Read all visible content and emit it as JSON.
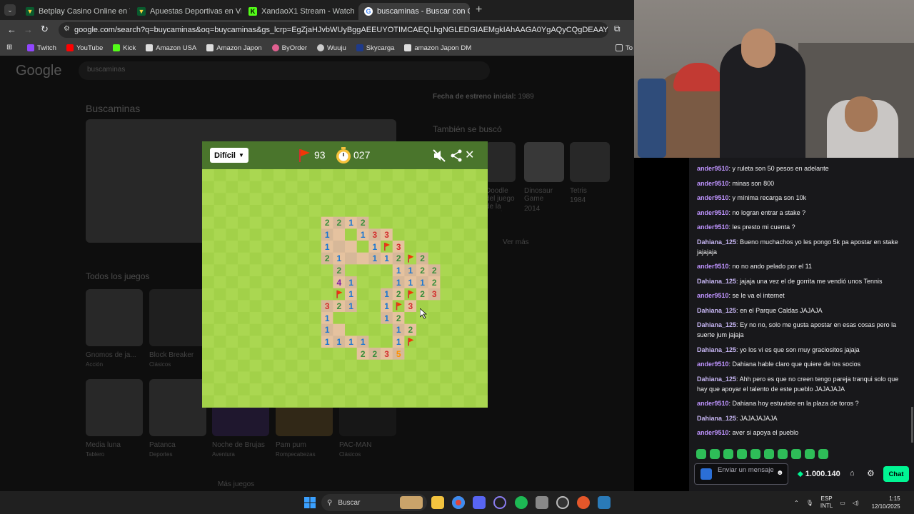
{
  "browser": {
    "tabs": [
      {
        "title": "Betplay Casino Online en Vivo |",
        "active": false
      },
      {
        "title": "Apuestas Deportivas en Vivo | A",
        "active": false
      },
      {
        "title": "XandaoX1 Stream - Watch",
        "active": false
      },
      {
        "title": "buscaminas - Buscar con Googl",
        "active": true
      }
    ],
    "new_tab": "+",
    "url": "google.com/search?q=buycaminas&oq=buycaminas&gs_lcrp=EgZjaHJvbWUyBggAEEUYOTIMCAEQLhgNGLEDGIAEMgkIAhAAGA0YgAQyCQgDEAAYDRiABDIJCAQQLhgNGI...",
    "bookmarks": [
      "Twitch",
      "YouTube",
      "Kick",
      "Amazon USA",
      "Amazon Japon",
      "ByOrder",
      "Wuuju",
      "Skycarga",
      "amazon Japon DM"
    ],
    "bookmarks_more": "To"
  },
  "google": {
    "logo": "Google",
    "query": "buscaminas",
    "heading": "Buscaminas",
    "release_label": "Fecha de estreno inicial:",
    "release_year": "1989",
    "also_searched": "También se buscó",
    "related": [
      {
        "name": "Doodle del juego de la Serpiente de los...",
        "sub": ""
      },
      {
        "name": "Dinosaur Game",
        "sub": "2014"
      },
      {
        "name": "Tetris",
        "sub": "1984"
      }
    ],
    "see_more": "Ver más",
    "all_games": "Todos los juegos",
    "games_row1": [
      {
        "name": "Gnomos de ja...",
        "sub": "Acción"
      },
      {
        "name": "Block Breaker",
        "sub": "Clásicos"
      }
    ],
    "games_row2": [
      {
        "name": "Media luna",
        "sub": "Tablero"
      },
      {
        "name": "Patanca",
        "sub": "Deportes"
      },
      {
        "name": "Noche de Brujas",
        "sub": "Aventura"
      },
      {
        "name": "Pam pum",
        "sub": "Rompecabezas"
      },
      {
        "name": "PAC-MAN",
        "sub": "Clásicos"
      }
    ],
    "more_games": "Más juegos"
  },
  "game": {
    "difficulty": "Difícil",
    "flags": "93",
    "timer": "027",
    "colors": {
      "dark": "#4a752c",
      "grass_a": "#aad751",
      "grass_b": "#a2d149",
      "dirt_a": "#e5c29f",
      "dirt_b": "#d7b899"
    },
    "rows": [
      "..............................",
      "..............................",
      "..............................",
      "..............................",
      "..........2212................",
      "..........1_.133..............",
      "..........1__.1F3.............",
      "..........21__112F2...........",
      "...........2....1122..........",
      "...........41...1112..........",
      "...........F1..12F23..........",
      "..........321..1F3............",
      "..........1....12.............",
      "..........1_....12............",
      "..........1111..1F............",
      ".............2235.............",
      "..............................",
      "..............................",
      "..............................",
      "..............................",
      ".............................."
    ]
  },
  "chat": {
    "messages": [
      {
        "user": "ander9510",
        "text": "y ruleta son 50 pesos en adelante"
      },
      {
        "user": "ander9510",
        "text": "minas son 800"
      },
      {
        "user": "ander9510",
        "text": "y mínima recarga son 10k"
      },
      {
        "user": "ander9510",
        "text": "no logran entrar a stake ?"
      },
      {
        "user": "ander9510",
        "text": "les presto mi cuenta ?"
      },
      {
        "user": "Dahiana_125",
        "text": "Bueno muchachos yo les pongo 5k pa apostar en stake jajajaja"
      },
      {
        "user": "ander9510",
        "text": "no no ando pelado por el 11"
      },
      {
        "user": "Dahiana_125",
        "text": "jajaja una vez el de gorrita me vendió unos Tennis"
      },
      {
        "user": "ander9510",
        "text": "se le va el internet"
      },
      {
        "user": "Dahiana_125",
        "text": "en el Parque Caldas JAJAJA"
      },
      {
        "user": "Dahiana_125",
        "text": "Ey no no, solo me gusta apostar en esas cosas pero la suerte jum jajaja"
      },
      {
        "user": "Dahiana_125",
        "text": "yo los vi es que son muy graciositos jajaja"
      },
      {
        "user": "ander9510",
        "text": "Dahiana hable claro que quiere de los socios"
      },
      {
        "user": "Dahiana_125",
        "text": "Ahh pero es que no creen tengo pareja tranqui solo que hay que apoyar el talento de este pueblo JAJAJAJA"
      },
      {
        "user": "ander9510",
        "text": "Dahiana hoy estuviste en la plaza de toros ?"
      },
      {
        "user": "Dahiana_125",
        "text": "JAJAJAJAJA"
      },
      {
        "user": "ander9510",
        "text": "aver si apoya el pueblo"
      }
    ],
    "user_colors": {
      "ander9510": "#bf94ff",
      "Dahiana_125": "#c8b7f5"
    },
    "input_placeholder": "Enviar un mensaje",
    "points": "1.000.140",
    "send_label": "Chat"
  },
  "taskbar": {
    "search": "Buscar",
    "lang": "ESP",
    "lang2": "INTL",
    "time": "1:15",
    "date": "12/10/2025"
  }
}
